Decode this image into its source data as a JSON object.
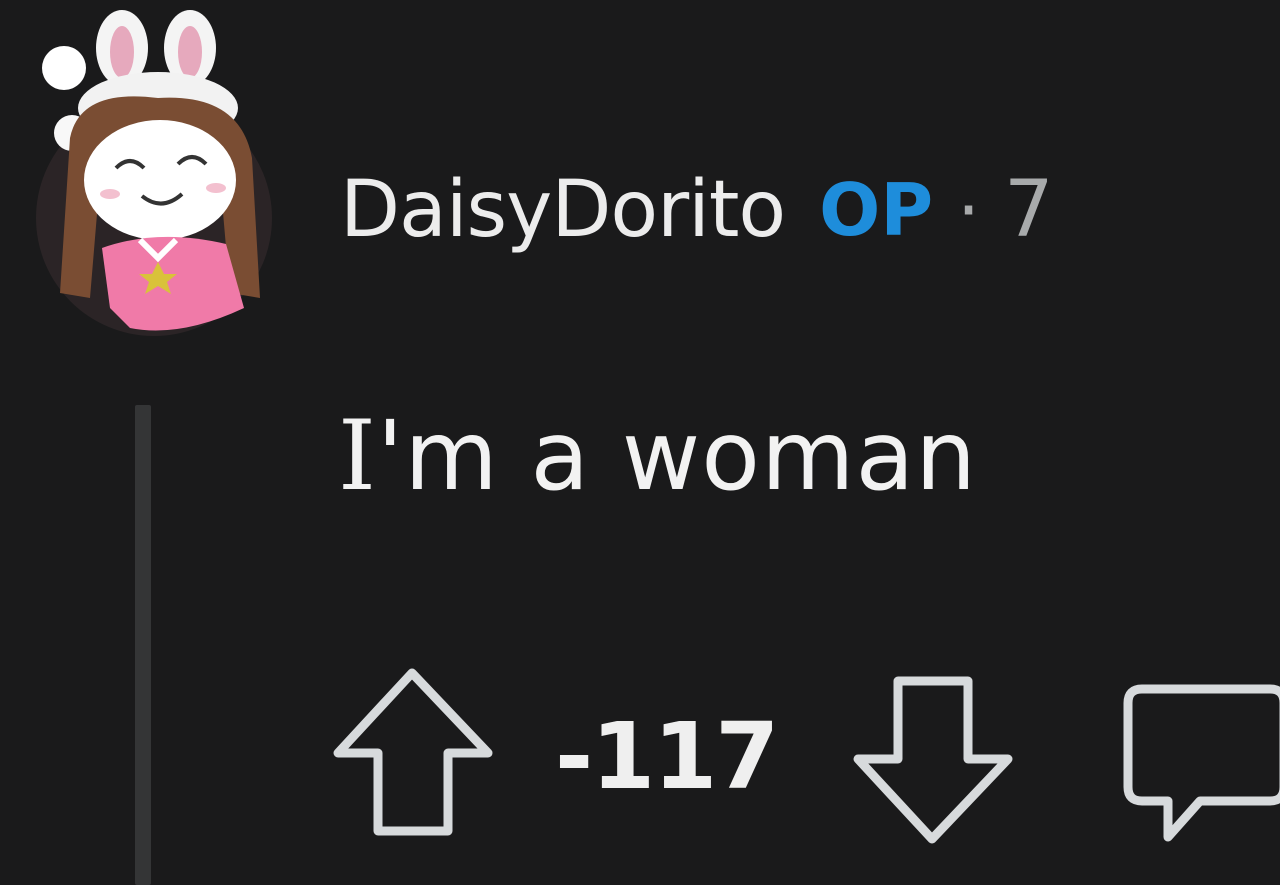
{
  "comment": {
    "username": "DaisyDorito",
    "op_badge": "OP",
    "separator": "·",
    "timestamp": "7",
    "body_prefix": "I",
    "body_rest": "'m a woman",
    "score": "-117"
  },
  "colors": {
    "background": "#1a1a1b",
    "op_badge": "#1e8ddb",
    "thread_line": "#343536",
    "avatar_shirt": "#f07aa8"
  },
  "icons": {
    "upvote": "arrow-up-outline-icon",
    "downvote": "arrow-down-outline-icon",
    "reply": "speech-bubble-outline-icon"
  }
}
